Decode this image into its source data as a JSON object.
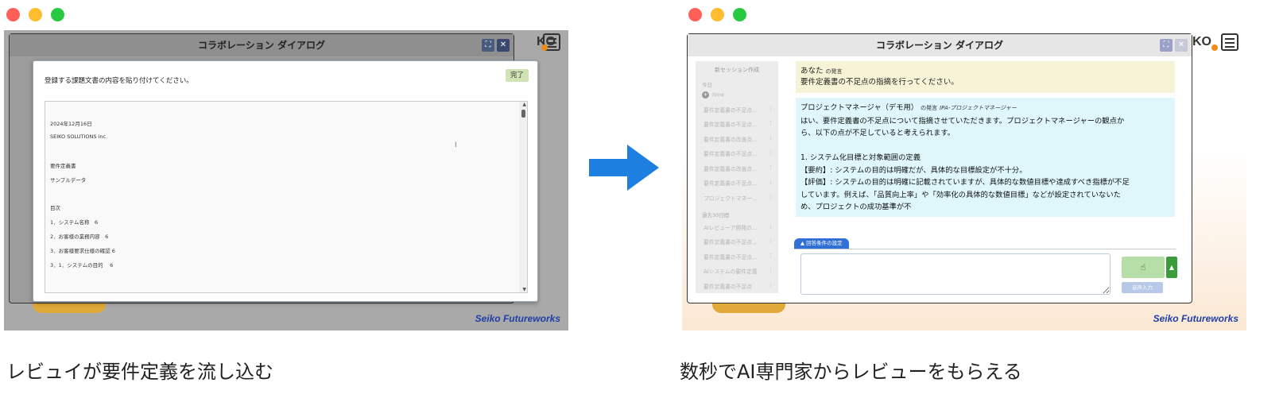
{
  "left": {
    "dialog_title": "コラボレーション ダイアログ",
    "modal": {
      "title": "登録する課題文書の内容を貼り付けてください。",
      "done_label": "完了",
      "document_lines": [
        "2024年12月16日",
        "SEIKO SOLUTIONS inc.",
        "要件定義書",
        "サンプルデータ",
        "目次",
        "1．システム名称　6",
        "2．お客様の業務内容　6",
        "3．お客様要求仕様の確認 6",
        "3．1．システムの目的　 6"
      ]
    },
    "brand_text": "Seiko Futureworks",
    "logo_text": "KO",
    "caption": "レビュイが要件定義を流し込む"
  },
  "right": {
    "dialog_title": "コラボレーション ダイアログ",
    "logo_text": "KO",
    "sidebar": {
      "new_session": "新セッション作成",
      "section_today": "今日",
      "new_item": "New",
      "today_items": [
        "要件定義書の不足点…",
        "要件定義書の不足点…",
        "要件定義書の改善点…",
        "要件定義書の不足点…",
        "要件定義書の改善点…",
        "要件定義書の不足点…",
        "プロジェクトマネー…"
      ],
      "section_30days": "過去30日間",
      "past_items": [
        "AIレビューア開発の…",
        "要件定義書の不足点…",
        "要件定義書の不足点…",
        "AIシステムの要件定義",
        "要件定義書の不足点"
      ],
      "kebab": "⋮"
    },
    "user_message": {
      "role": "あなた",
      "role_suffix": "の発言",
      "text": "要件定義書の不足点の指摘を行ってください。"
    },
    "ai_message": {
      "role": "プロジェクトマネージャ（デモ用）",
      "role_suffix": "の発言",
      "role_tag": "IPA-プロジェクトマネージャー",
      "lines": [
        "はい、要件定義書の不足点について指摘させていただきます。プロジェクトマネージャーの観点か",
        "ら、以下の点が不足していると考えられます。",
        "",
        "1. システム化目標と対象範囲の定義",
        "【要約】: システムの目的は明確だが、具体的な目標設定が不十分。",
        "【評価】: システムの目的は明確に記載されていますが、具体的な数値目標や達成すべき指標が不足",
        "しています。例えば、「品質向上率」や「効率化の具体的な数値目標」などが設定されていないた",
        "め、プロジェクトの成功基準が不"
      ]
    },
    "conditions_tab": "▲ 回答条件の設定",
    "input_placeholder": "",
    "voice_label": "音声入力",
    "brand_text": "Seiko Futureworks",
    "caption": "数秒でAI専門家からレビューをもらえる"
  },
  "colors": {
    "traffic_red": "#fe5f57",
    "traffic_yellow": "#febc2e",
    "traffic_green": "#28c840",
    "arrow_blue": "#1d7fe0",
    "header_btn_blue": "#3a5fb0"
  }
}
